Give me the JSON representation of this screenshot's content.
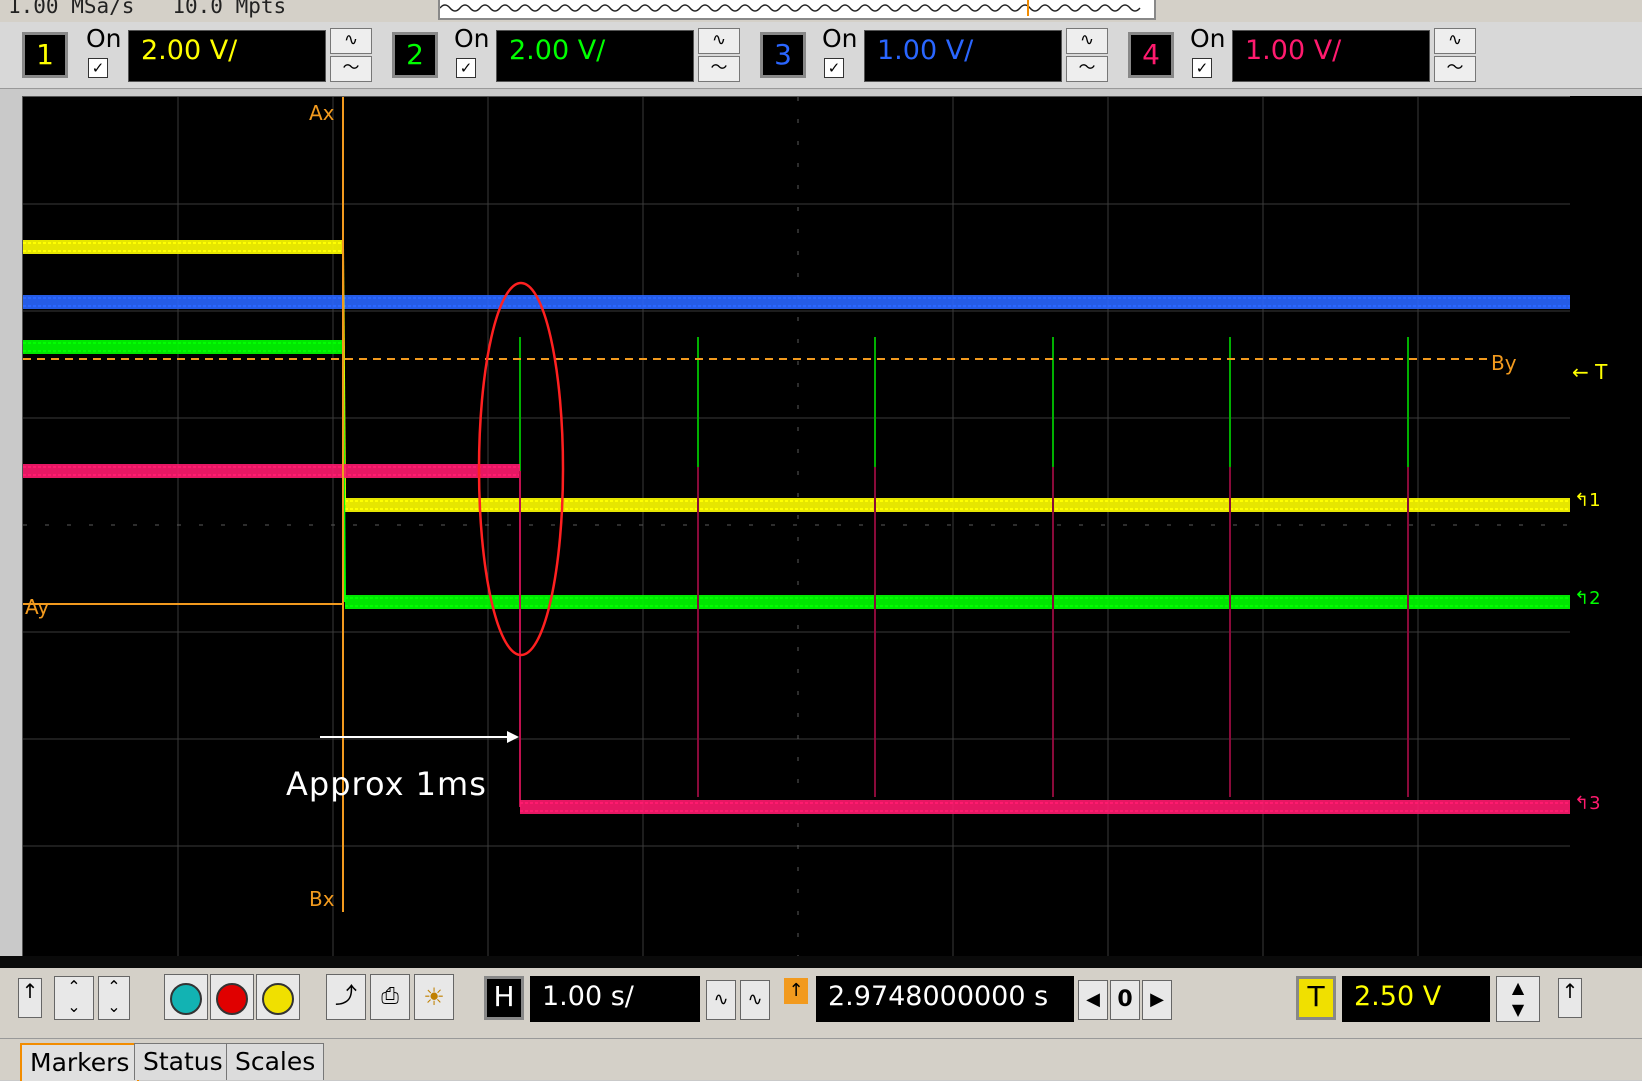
{
  "acquisition": {
    "sample_rate": "1.00 MSa/s",
    "memory_depth": "10.0 Mpts"
  },
  "channels": [
    {
      "number": "1",
      "on_label": "On",
      "scale": "2.00 V/",
      "color": "#ffff00"
    },
    {
      "number": "2",
      "on_label": "On",
      "scale": "2.00 V/",
      "color": "#00ff00"
    },
    {
      "number": "3",
      "on_label": "On",
      "scale": "1.00 V/",
      "color": "#2a66ff"
    },
    {
      "number": "4",
      "on_label": "On",
      "scale": "1.00 V/",
      "color": "#ff1a6e"
    }
  ],
  "markers": {
    "ax": "Ax",
    "bx": "Bx",
    "ay": "Ay",
    "by": "By",
    "trigger": "T"
  },
  "ground_labels": {
    "ch1": "1",
    "ch2": "2",
    "ch3": "3"
  },
  "annotation": {
    "text": "Approx 1ms"
  },
  "horizontal": {
    "label": "H",
    "scale": "1.00 s/",
    "delay": "2.9748000000 s",
    "position_value": "0"
  },
  "trigger": {
    "label": "T",
    "level": "2.50 V"
  },
  "tabs": [
    "Markers",
    "Status",
    "Scales"
  ],
  "colors": {
    "marker": "#f29a1e",
    "annotation_ellipse": "#ff2020",
    "annotation_text": "#ffffff"
  }
}
